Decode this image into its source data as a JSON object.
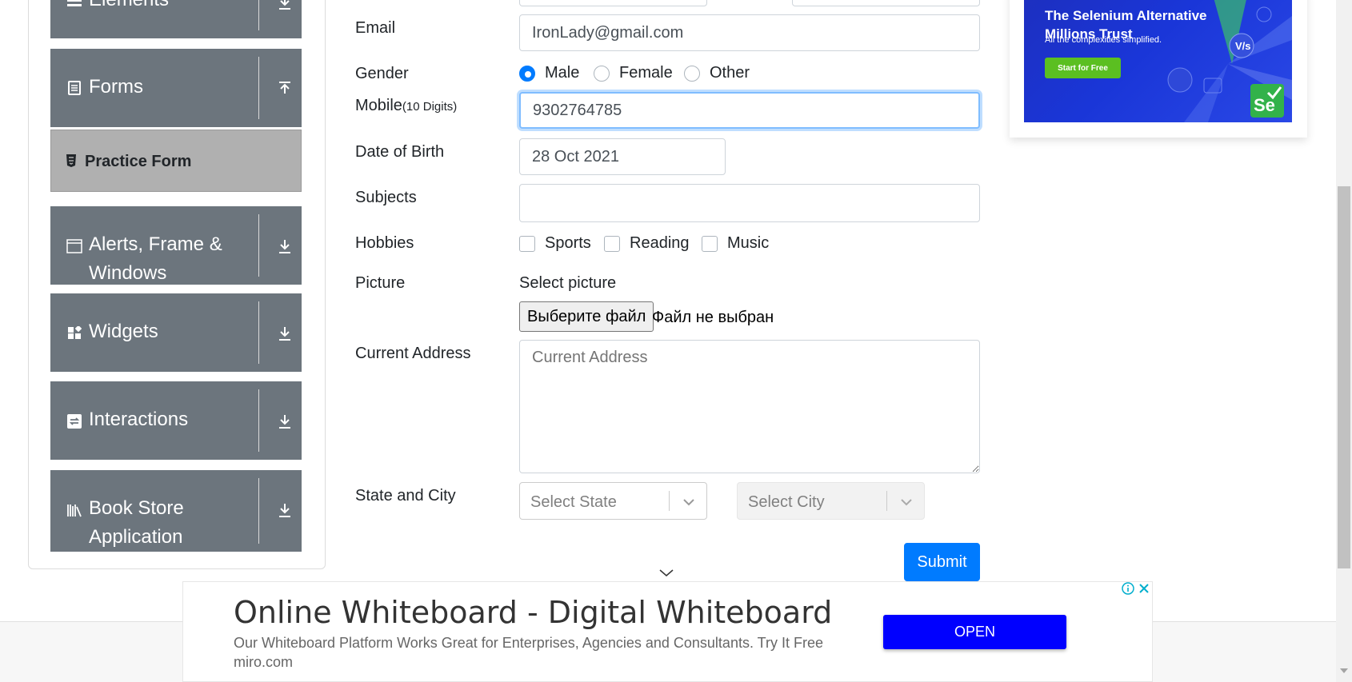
{
  "sidebar": {
    "groups": [
      {
        "title": "Elements",
        "icon": "list-icon",
        "arrow": "download-arrow-icon"
      },
      {
        "title": "Forms",
        "icon": "document-icon",
        "arrow": "upload-arrow-icon"
      },
      {
        "title": "Alerts, Frame & Windows",
        "icon": "window-icon",
        "arrow": "download-arrow-icon"
      },
      {
        "title": "Widgets",
        "icon": "widgets-icon",
        "arrow": "download-arrow-icon"
      },
      {
        "title": "Interactions",
        "icon": "interactions-icon",
        "arrow": "download-arrow-icon"
      },
      {
        "title": "Book Store Application",
        "icon": "books-icon",
        "arrow": "download-arrow-icon"
      }
    ],
    "active_item": "Practice Form"
  },
  "form": {
    "email_label": "Email",
    "email_value": "IronLady@gmail.com",
    "gender_label": "Gender",
    "gender_options": [
      "Male",
      "Female",
      "Other"
    ],
    "gender_selected": "Male",
    "mobile_label": "Mobile",
    "mobile_hint": "(10 Digits)",
    "mobile_value": "9302764785",
    "dob_label": "Date of Birth",
    "dob_value": "28 Oct 2021",
    "subjects_label": "Subjects",
    "subjects_value": "",
    "hobbies_label": "Hobbies",
    "hobbies": [
      "Sports",
      "Reading",
      "Music"
    ],
    "picture_label": "Picture",
    "picture_hint": "Select picture",
    "file_button": "Выберите файл",
    "file_status": "Файл не выбран",
    "address_label": "Current Address",
    "address_placeholder": "Current Address",
    "state_city_label": "State and City",
    "state_placeholder": "Select State",
    "city_placeholder": "Select City",
    "submit_label": "Submit"
  },
  "side_ad": {
    "headline": "The Selenium Alternative Millions Trust",
    "subline": "All the complexities simplified.",
    "cta": "Start for Free",
    "badge": "Se"
  },
  "banner_ad": {
    "title": "Online Whiteboard - Digital Whiteboard",
    "description": "Our Whiteboard Platform Works Great for Enterprises, Agencies and Consultants. Try It Free miro.com",
    "cta": "OPEN"
  },
  "colors": {
    "sidebar_group": "#6c757d",
    "sidebar_active": "#b0b0b0",
    "primary": "#007bff",
    "ad_blue": "#1a36d8",
    "banner_button": "#0000ff"
  }
}
